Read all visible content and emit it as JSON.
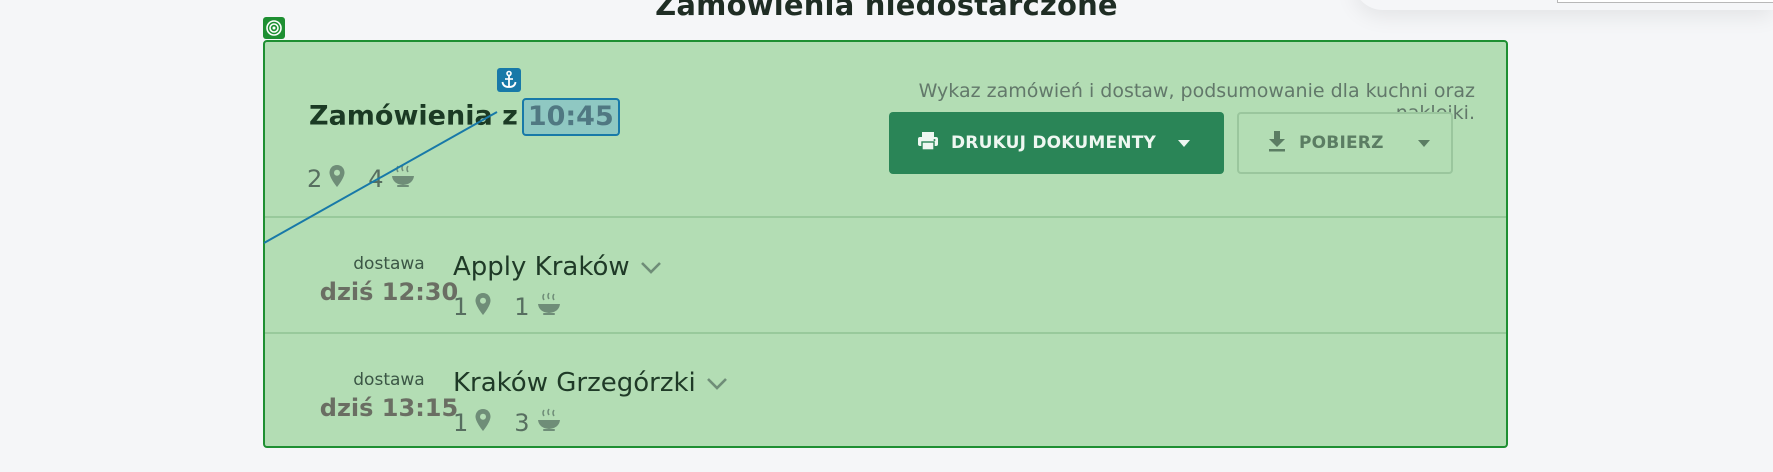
{
  "page": {
    "title": "Zamówienia niedostarczone"
  },
  "colors": {
    "panel_bg": "#b3ddb4",
    "panel_border": "#1e8f32",
    "primary": "#2a8557",
    "anchor_blue": "#1879a8"
  },
  "icons": {
    "target": "target-icon",
    "anchor": "anchor-icon",
    "location": "location-pin-icon",
    "meal": "bowl-icon",
    "printer": "printer-icon",
    "download": "download-icon",
    "caret": "caret-down-icon",
    "chevron": "chevron-down-icon"
  },
  "header": {
    "title_prefix": "Zamówienia z",
    "time": "10:45",
    "locations_count": "2",
    "meals_count": "4",
    "description": "Wykaz zamówień i dostaw, podsumowanie dla kuchni oraz naklejki.",
    "print_button": "DRUKUJ DOKUMENTY",
    "download_button": "POBIERZ"
  },
  "deliveries": [
    {
      "type": "dostawa",
      "time": "dziś 12:30",
      "name": "Apply Kraków",
      "locations": "1",
      "meals": "1"
    },
    {
      "type": "dostawa",
      "time": "dziś 13:15",
      "name": "Kraków Grzegórzki",
      "locations": "1",
      "meals": "3"
    }
  ]
}
